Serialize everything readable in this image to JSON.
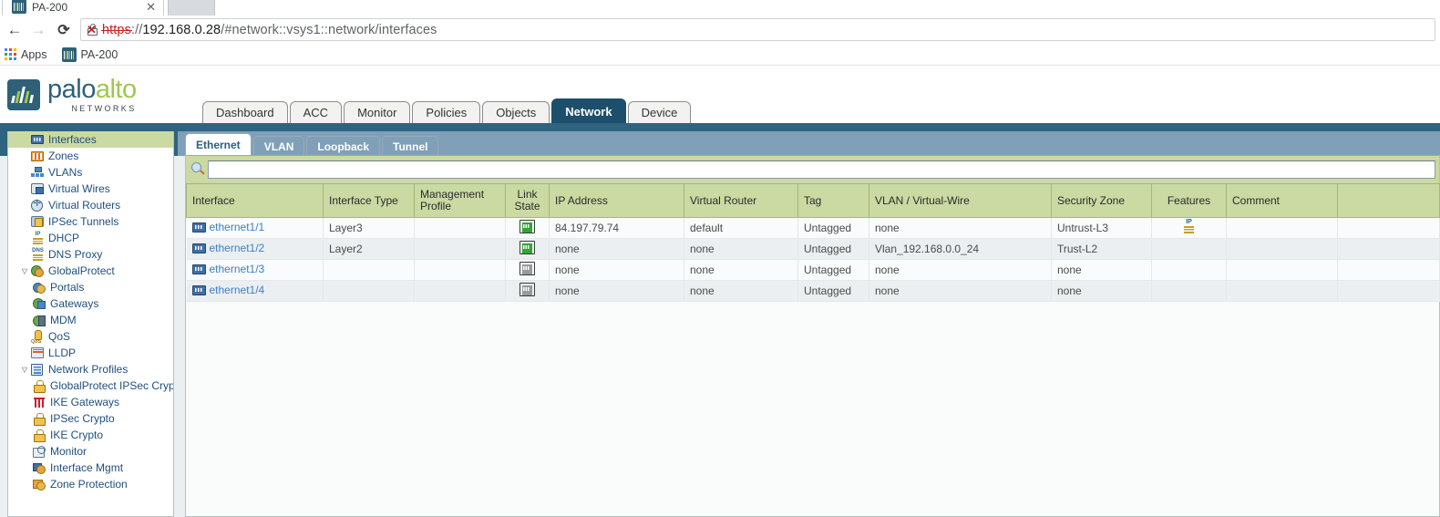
{
  "browser": {
    "tab_title": "PA-200",
    "tab_close": "✕",
    "back_icon": "←",
    "forward_icon": "→",
    "reload_icon": "⟳",
    "url_scheme": "https",
    "url_rest": "://192.168.0.28/#network::vsys1::network/interfaces",
    "url_host": "192.168.0.28",
    "url_prefix": "://",
    "url_path": "/#network::vsys1::network/interfaces",
    "apps_label": "Apps",
    "bookmark_label": "PA-200"
  },
  "brand": {
    "word1": "palo",
    "word2": "alto",
    "subtitle": "NETWORKS"
  },
  "main_tabs": [
    {
      "label": "Dashboard",
      "active": false
    },
    {
      "label": "ACC",
      "active": false
    },
    {
      "label": "Monitor",
      "active": false
    },
    {
      "label": "Policies",
      "active": false
    },
    {
      "label": "Objects",
      "active": false
    },
    {
      "label": "Network",
      "active": true
    },
    {
      "label": "Device",
      "active": false
    }
  ],
  "sub_tabs": [
    {
      "label": "Ethernet",
      "active": true
    },
    {
      "label": "VLAN",
      "active": false
    },
    {
      "label": "Loopback",
      "active": false
    },
    {
      "label": "Tunnel",
      "active": false
    }
  ],
  "sidebar": {
    "items": [
      {
        "label": "Interfaces",
        "level": 1,
        "icon": "interfaces-icon",
        "selected": true,
        "twisty": ""
      },
      {
        "label": "Zones",
        "level": 1,
        "icon": "zones-icon",
        "selected": false,
        "twisty": ""
      },
      {
        "label": "VLANs",
        "level": 1,
        "icon": "vlans-icon",
        "selected": false,
        "twisty": ""
      },
      {
        "label": "Virtual Wires",
        "level": 1,
        "icon": "virtual-wires-icon",
        "selected": false,
        "twisty": ""
      },
      {
        "label": "Virtual Routers",
        "level": 1,
        "icon": "virtual-routers-icon",
        "selected": false,
        "twisty": ""
      },
      {
        "label": "IPSec Tunnels",
        "level": 1,
        "icon": "ipsec-tunnels-icon",
        "selected": false,
        "twisty": ""
      },
      {
        "label": "DHCP",
        "level": 1,
        "icon": "dhcp-icon",
        "selected": false,
        "twisty": ""
      },
      {
        "label": "DNS Proxy",
        "level": 1,
        "icon": "dns-proxy-icon",
        "selected": false,
        "twisty": ""
      },
      {
        "label": "GlobalProtect",
        "level": 1,
        "icon": "globalprotect-icon",
        "selected": false,
        "twisty": "▽"
      },
      {
        "label": "Portals",
        "level": 2,
        "icon": "portals-icon",
        "selected": false,
        "twisty": ""
      },
      {
        "label": "Gateways",
        "level": 2,
        "icon": "gateways-icon",
        "selected": false,
        "twisty": ""
      },
      {
        "label": "MDM",
        "level": 2,
        "icon": "mdm-icon",
        "selected": false,
        "twisty": ""
      },
      {
        "label": "QoS",
        "level": 1,
        "icon": "qos-icon",
        "selected": false,
        "twisty": ""
      },
      {
        "label": "LLDP",
        "level": 1,
        "icon": "lldp-icon",
        "selected": false,
        "twisty": ""
      },
      {
        "label": "Network Profiles",
        "level": 1,
        "icon": "network-profiles-icon",
        "selected": false,
        "twisty": "▽"
      },
      {
        "label": "GlobalProtect IPSec Crypto",
        "level": 2,
        "icon": "lock-icon",
        "selected": false,
        "twisty": ""
      },
      {
        "label": "IKE Gateways",
        "level": 2,
        "icon": "ike-gateways-icon",
        "selected": false,
        "twisty": ""
      },
      {
        "label": "IPSec Crypto",
        "level": 2,
        "icon": "lock-icon",
        "selected": false,
        "twisty": ""
      },
      {
        "label": "IKE Crypto",
        "level": 2,
        "icon": "lock-icon",
        "selected": false,
        "twisty": ""
      },
      {
        "label": "Monitor",
        "level": 2,
        "icon": "monitor-icon",
        "selected": false,
        "twisty": ""
      },
      {
        "label": "Interface Mgmt",
        "level": 2,
        "icon": "interface-mgmt-icon",
        "selected": false,
        "twisty": ""
      },
      {
        "label": "Zone Protection",
        "level": 2,
        "icon": "zone-protection-icon",
        "selected": false,
        "twisty": ""
      }
    ]
  },
  "search": {
    "value": "",
    "placeholder": ""
  },
  "table": {
    "columns": [
      "Interface",
      "Interface Type",
      "Management Profile",
      "Link State",
      "IP Address",
      "Virtual Router",
      "Tag",
      "VLAN / Virtual-Wire",
      "Security Zone",
      "Features",
      "Comment",
      ""
    ],
    "rows": [
      {
        "interface": "ethernet1/1",
        "interface_type": "Layer3",
        "management_profile": "",
        "link_state": "up",
        "ip_address": "84.197.79.74",
        "virtual_router": "default",
        "tag": "Untagged",
        "vlan_virtual_wire": "none",
        "security_zone": "Untrust-L3",
        "features": "dhcp-client-icon",
        "comment": ""
      },
      {
        "interface": "ethernet1/2",
        "interface_type": "Layer2",
        "management_profile": "",
        "link_state": "up",
        "ip_address": "none",
        "virtual_router": "none",
        "tag": "Untagged",
        "vlan_virtual_wire": "Vlan_192.168.0.0_24",
        "security_zone": "Trust-L2",
        "features": "",
        "comment": ""
      },
      {
        "interface": "ethernet1/3",
        "interface_type": "",
        "management_profile": "",
        "link_state": "down",
        "ip_address": "none",
        "virtual_router": "none",
        "tag": "Untagged",
        "vlan_virtual_wire": "none",
        "security_zone": "none",
        "features": "",
        "comment": ""
      },
      {
        "interface": "ethernet1/4",
        "interface_type": "",
        "management_profile": "",
        "link_state": "down",
        "ip_address": "none",
        "virtual_router": "none",
        "tag": "Untagged",
        "vlan_virtual_wire": "none",
        "security_zone": "none",
        "features": "",
        "comment": ""
      }
    ],
    "features_icon_text": "IP"
  },
  "colors": {
    "brand_teal": "#2e6079",
    "brand_green": "#9ec94a",
    "tab_active": "#1d4f6c",
    "header_band": "#2e6480",
    "subtab_inactive": "#7fa0b8",
    "table_header": "#cbd9a2",
    "link_up": "#2fa82f",
    "link_down": "#9a9a9a",
    "link_text": "#3b7fc4"
  }
}
